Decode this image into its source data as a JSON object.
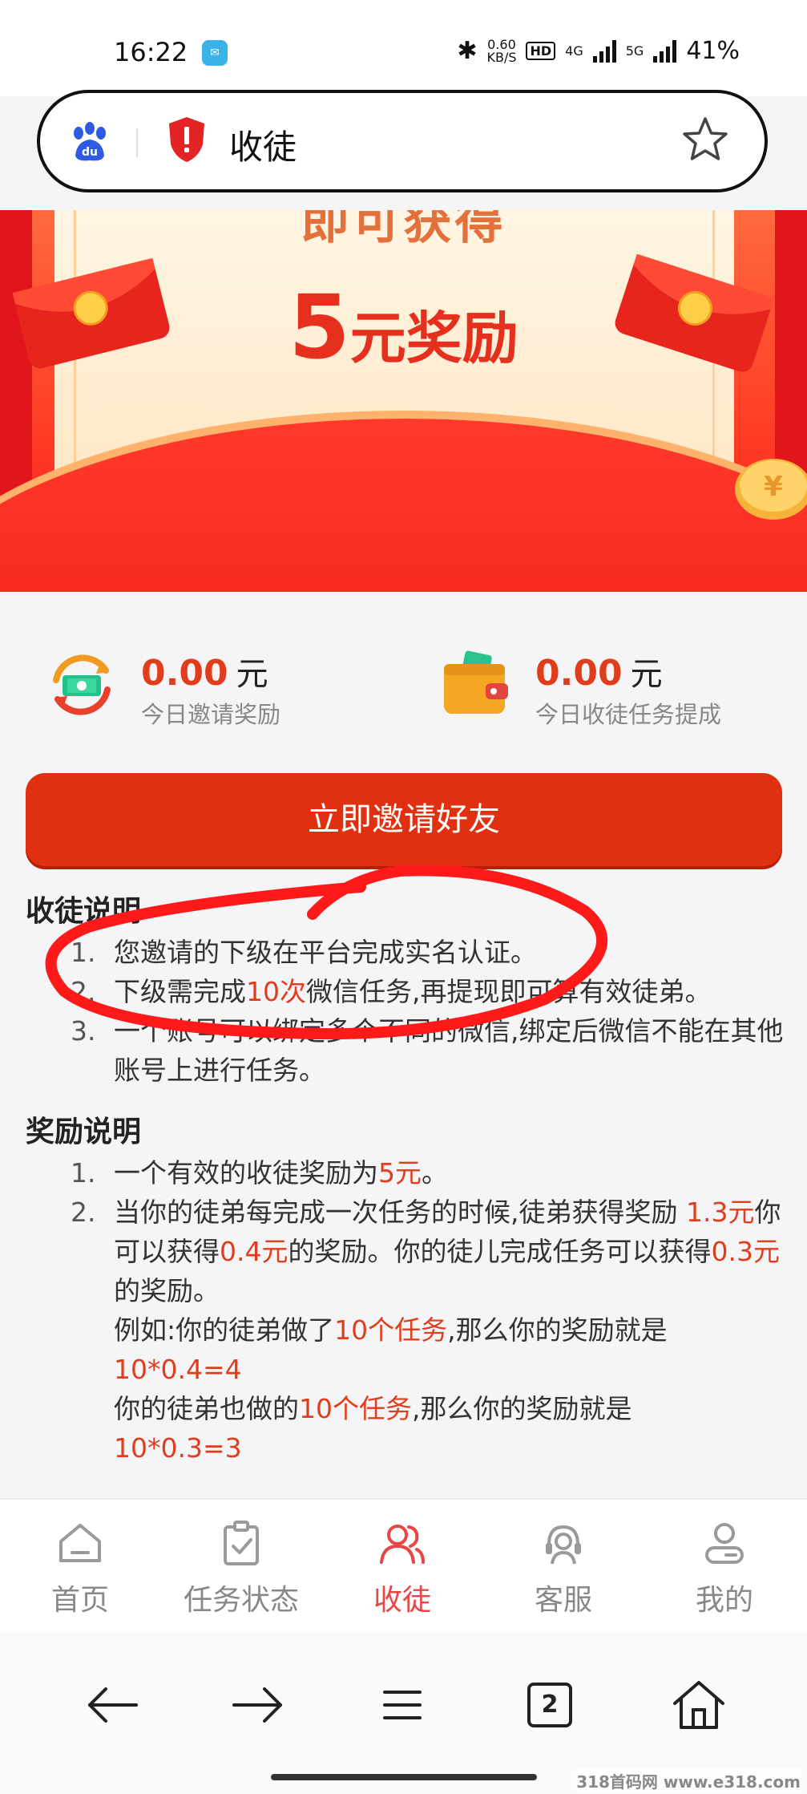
{
  "status_bar": {
    "time": "16:22",
    "speed_value": "0.60",
    "speed_unit": "KB/S",
    "hd": "HD",
    "net1": "4G",
    "net2": "5G",
    "battery": "41%"
  },
  "url_bar": {
    "title": "收徒"
  },
  "banner": {
    "top_text": "即可获得",
    "amount": "5",
    "amount_suffix": "元奖励"
  },
  "stats": [
    {
      "value": "0.00",
      "unit": "元",
      "label": "今日邀请奖励"
    },
    {
      "value": "0.00",
      "unit": "元",
      "label": "今日收徒任务提成"
    }
  ],
  "invite_button": "立即邀请好友",
  "apprentice_section": {
    "title": "收徒说明",
    "items": [
      {
        "index": "1.",
        "text": "您邀请的下级在平台完成实名认证。"
      },
      {
        "index": "2.",
        "text_a": "下级需完成",
        "highlight": "10次",
        "text_b": "微信任务,再提现即可算有效徒弟。"
      },
      {
        "index": "3.",
        "text": "一个账号可以绑定多个不同的微信,绑定后微信不能在其他账号上进行任务。"
      }
    ]
  },
  "reward_section": {
    "title": "奖励说明",
    "item1": {
      "index": "1.",
      "text": "一个有效的收徒奖励为",
      "highlight": "5元",
      "end": "。"
    },
    "item2": {
      "index": "2.",
      "p1": "当你的徒弟每完成一次任务的时候,徒弟获得奖励 ",
      "h1": "1.3元",
      "p2": "你可以获得",
      "h2": "0.4元",
      "p3": "的奖励。你的徒儿完成任务可以获得",
      "h3": "0.3元",
      "p4": "的奖励。",
      "ex1_a": "例如:你的徒弟做了",
      "ex1_h": "10个任务",
      "ex1_b": ",那么你的奖励就是",
      "ex1_formula": "10*0.4=4",
      "ex2_a": "你的徒弟也做的",
      "ex2_h": "10个任务",
      "ex2_b": ",那么你的奖励就是",
      "ex2_formula": "10*0.3=3"
    }
  },
  "bottom_nav": [
    {
      "label": "首页"
    },
    {
      "label": "任务状态"
    },
    {
      "label": "收徒"
    },
    {
      "label": "客服"
    },
    {
      "label": "我的"
    }
  ],
  "system_nav": {
    "tab_count": "2"
  },
  "watermark": "318首码网 www.e318.com",
  "colors": {
    "accent_red": "#e0300f",
    "highlight_red": "#e03d1c",
    "active_nav": "#e84545"
  }
}
